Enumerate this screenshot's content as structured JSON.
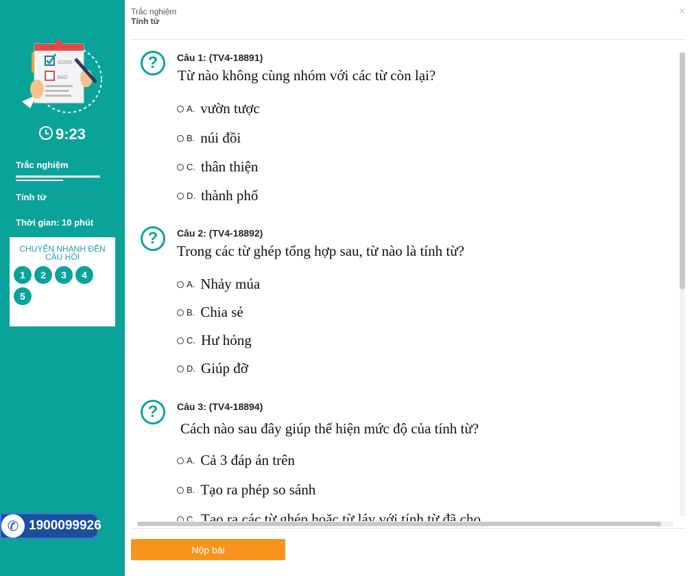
{
  "sidebar": {
    "illustration": {
      "good_label": "GOOD",
      "bad_label": "BAD"
    },
    "timer": "9:23",
    "quiz_label": "Trắc nghiệm",
    "topic_label": "Tính từ",
    "time_label": "Thời gian: 10 phút",
    "jump_title": "CHUYỂN NHANH ĐẾN CÂU HỎI",
    "jump_numbers": [
      "1",
      "2",
      "3",
      "4",
      "5"
    ],
    "hotline": "1900099926"
  },
  "header": {
    "quiz": "Trắc nghiệm",
    "topic": "Tính từ",
    "close": "×"
  },
  "questions": [
    {
      "code": "Câu 1: (TV4-18891)",
      "text": "Từ nào không cùng nhóm với các từ còn lại?",
      "options": [
        {
          "letter": "A.",
          "text": "vườn tược"
        },
        {
          "letter": "B.",
          "text": "núi đồi"
        },
        {
          "letter": "C.",
          "text": "thân thiện"
        },
        {
          "letter": "D.",
          "text": "thành phố"
        }
      ]
    },
    {
      "code": "Câu 2: (TV4-18892)",
      "text": "Trong các từ ghép tổng hợp sau, từ nào là tính từ?",
      "options": [
        {
          "letter": "A.",
          "text": "Nhảy múa"
        },
        {
          "letter": "B.",
          "text": "Chia sẻ"
        },
        {
          "letter": "C.",
          "text": "Hư hỏng"
        },
        {
          "letter": "D.",
          "text": "Giúp đỡ"
        }
      ]
    },
    {
      "code": "Câu 3: (TV4-18894)",
      "text": "Cách nào sau đây giúp thể hiện mức độ của tính từ?",
      "options": [
        {
          "letter": "A.",
          "text": "Cả 3 đáp án trên"
        },
        {
          "letter": "B.",
          "text": "Tạo ra phép so sánh"
        },
        {
          "letter": "C.",
          "text": "Tạo ra các từ ghép hoặc từ láy với tính từ đã cho"
        }
      ]
    }
  ],
  "submit_label": "Nộp bài",
  "colors": {
    "accent": "#0aa39a",
    "submit": "#f7941d",
    "hotline": "#1a4f9c"
  }
}
